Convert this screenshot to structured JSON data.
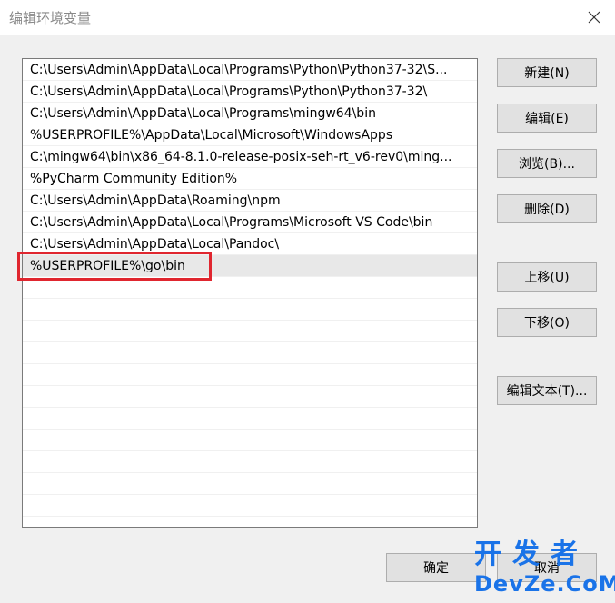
{
  "window": {
    "title": "编辑环境变量",
    "close_label": "×"
  },
  "paths": [
    "C:\\Users\\Admin\\AppData\\Local\\Programs\\Python\\Python37-32\\S...",
    "C:\\Users\\Admin\\AppData\\Local\\Programs\\Python\\Python37-32\\",
    "C:\\Users\\Admin\\AppData\\Local\\Programs\\mingw64\\bin",
    "%USERPROFILE%\\AppData\\Local\\Microsoft\\WindowsApps",
    "C:\\mingw64\\bin\\x86_64-8.1.0-release-posix-seh-rt_v6-rev0\\ming...",
    "%PyCharm Community Edition%",
    "C:\\Users\\Admin\\AppData\\Roaming\\npm",
    "C:\\Users\\Admin\\AppData\\Local\\Programs\\Microsoft VS Code\\bin",
    "C:\\Users\\Admin\\AppData\\Local\\Pandoc\\",
    "%USERPROFILE%\\go\\bin"
  ],
  "empty_rows": 12,
  "buttons": {
    "new": "新建(N)",
    "edit": "编辑(E)",
    "browse": "浏览(B)...",
    "delete": "删除(D)",
    "move_up": "上移(U)",
    "move_down": "下移(O)",
    "edit_text": "编辑文本(T)...",
    "ok": "确定",
    "cancel": "取消"
  },
  "watermark": {
    "line1": "开发者",
    "line2": "DevZe.CoM"
  },
  "colors": {
    "highlight": "#e0262f",
    "watermark": "#1a73e8"
  }
}
